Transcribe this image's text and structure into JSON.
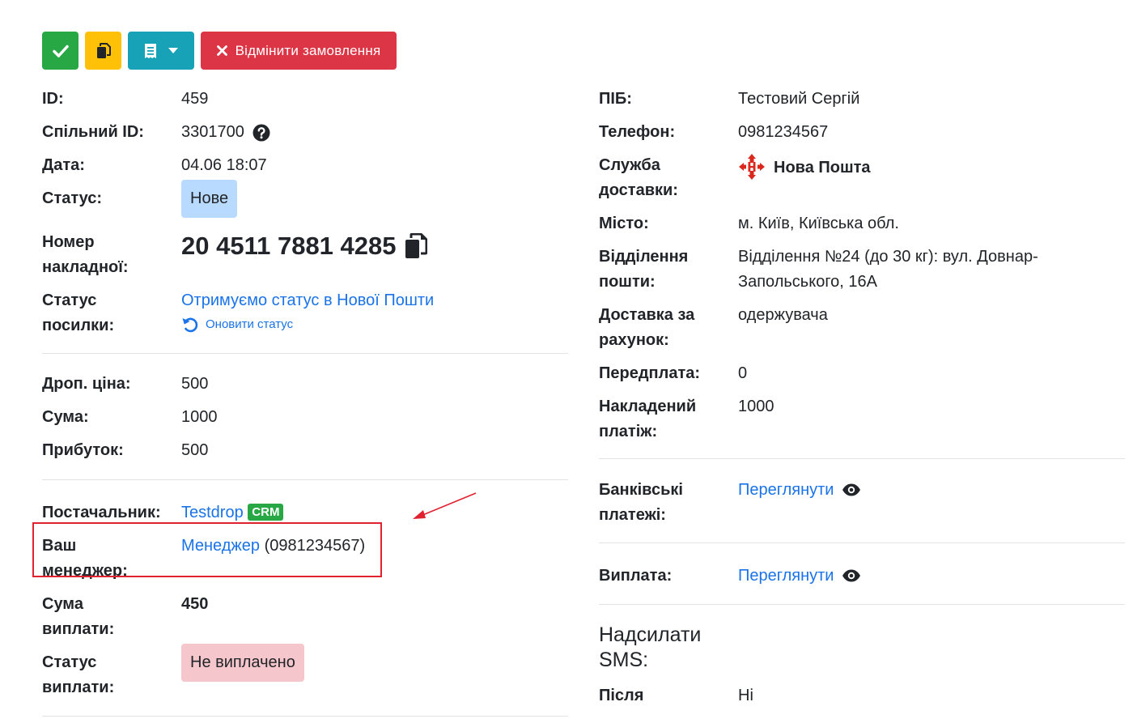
{
  "toolbar": {
    "cancel_label": "Відмінити замовлення",
    "colors": {
      "success": "#28a745",
      "warning": "#ffc107",
      "info": "#17a2b8",
      "danger": "#dc3545"
    }
  },
  "left": {
    "id_label": "ID:",
    "id_value": "459",
    "shared_id_label": "Спільний ID:",
    "shared_id_value": "3301700",
    "date_label": "Дата:",
    "date_value": "04.06 18:07",
    "status_label": "Статус:",
    "status_value": "Нове",
    "ttn_label_1": "Номер",
    "ttn_label_2": "накладної:",
    "ttn_value": "20 4511 7881 4285",
    "parcel_status_label_1": "Статус",
    "parcel_status_label_2": "посилки:",
    "parcel_status_value": "Отримуємо статус в Нової Пошти",
    "refresh_status_label": "Оновити статус",
    "drop_price_label": "Дроп. ціна:",
    "drop_price_value": "500",
    "sum_label": "Сума:",
    "sum_value": "1000",
    "profit_label": "Прибуток:",
    "profit_value": "500",
    "supplier_label": "Постачальник:",
    "supplier_value": "Testdrop",
    "supplier_badge": "CRM",
    "manager_label_1": "Ваш",
    "manager_label_2": "менеджер:",
    "manager_name": "Менеджер",
    "manager_phone": "(0981234567)",
    "payout_sum_label_1": "Сума",
    "payout_sum_label_2": "виплати:",
    "payout_sum_value": "450",
    "payout_status_label_1": "Статус",
    "payout_status_label_2": "виплати:",
    "payout_status_value": "Не виплачено"
  },
  "right": {
    "name_label": "ПІБ:",
    "name_value": "Тестовий Сергій",
    "phone_label": "Телефон:",
    "phone_value": "0981234567",
    "delivery_label_1": "Служба",
    "delivery_label_2": "доставки:",
    "delivery_value": "Нова Пошта",
    "city_label": "Місто:",
    "city_value": "м. Київ, Київська обл.",
    "branch_label_1": "Відділення",
    "branch_label_2": "пошти:",
    "branch_value_1": "Відділення №24 (до 30 кг): вул. Довнар-",
    "branch_value_2": "Запольського, 16А",
    "payer_label_1": "Доставка за",
    "payer_label_2": "рахунок:",
    "payer_value": "одержувача",
    "prepay_label": "Передплата:",
    "prepay_value": "0",
    "cod_label_1": "Накладений",
    "cod_label_2": "платіж:",
    "cod_value": "1000",
    "bank_label_1": "Банківські",
    "bank_label_2": "платежі:",
    "bank_link": "Переглянути",
    "payout_label": "Виплата:",
    "payout_link": "Переглянути",
    "sms_heading_1": "Надсилати",
    "sms_heading_2": "SMS:",
    "after_label": "Після",
    "after_value": "Ні"
  },
  "annotation": {
    "color": "#e0212f"
  }
}
